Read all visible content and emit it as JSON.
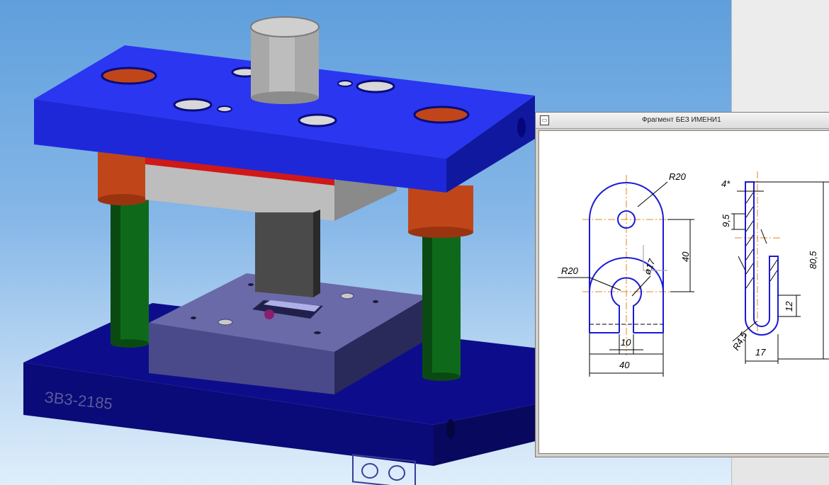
{
  "viewport": {
    "part_marking": "ЗВ3-2185",
    "colors": {
      "top_plate": "#1f2ce6",
      "base_plate": "#0c0c82",
      "guide_pillars": "#0e6a1a",
      "bushings": "#c0461a",
      "die_block": "#4a4a8c",
      "punch": "#3c3c3c",
      "shank": "#a8a8a8",
      "background_top": "#5f9fdc",
      "background_bottom": "#dfeefb"
    }
  },
  "fragment_window": {
    "title": "Фрагмент БЕЗ ИМЕНИ1",
    "icon": "document-icon",
    "dimensions": {
      "top_radius": "R20",
      "hole_diameter": "ø17",
      "lower_radius": "R20",
      "height_40": "40",
      "slot_width": "10",
      "total_width": "40",
      "thickness": "4*",
      "offset_95": "9,5",
      "total_height": "80,5",
      "bend_height": "12",
      "bend_radius": "R4,5",
      "bend_width": "17"
    },
    "colors": {
      "outline": "#1a1ad8",
      "centerline": "#e08a20",
      "dimension": "#000000",
      "axis": "#9a9a9a"
    }
  }
}
